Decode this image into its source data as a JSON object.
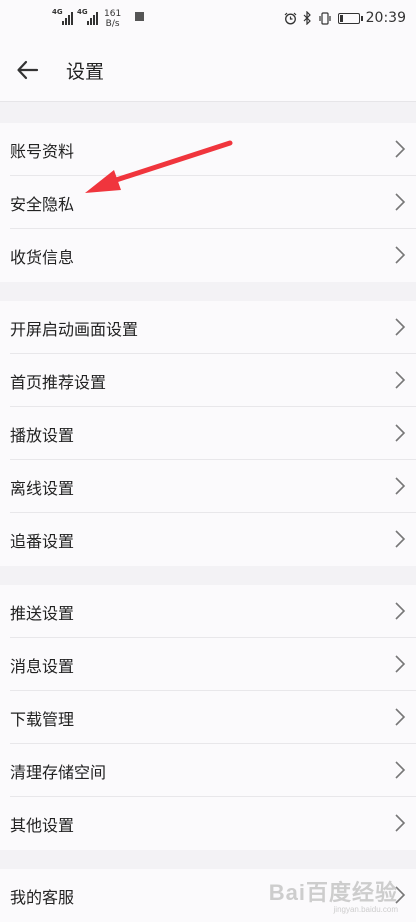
{
  "status_bar": {
    "network1": "4G",
    "network2": "4G",
    "speed_value": "161",
    "speed_unit": "B/s",
    "time": "20:39",
    "icons": [
      "alarm-icon",
      "bluetooth-icon",
      "vibrate-icon",
      "battery-icon"
    ],
    "battery_level": 0.2
  },
  "header": {
    "title": "设置",
    "back_icon": "arrow-left-icon"
  },
  "groups": [
    {
      "items": [
        "账号资料",
        "安全隐私",
        "收货信息"
      ]
    },
    {
      "items": [
        "开屏启动画面设置",
        "首页推荐设置",
        "播放设置",
        "离线设置",
        "追番设置"
      ]
    },
    {
      "items": [
        "推送设置",
        "消息设置",
        "下载管理",
        "清理存储空间",
        "其他设置"
      ]
    },
    {
      "items": [
        "我的客服"
      ]
    }
  ],
  "annotation": {
    "color": "#f0353d",
    "icon": "red-arrow-annotation"
  },
  "watermark": {
    "main": "Bai百度经验",
    "sub": "jingyan.baidu.com"
  },
  "colors": {
    "background": "#f3f2f5",
    "row_background": "#fbfafc",
    "divider": "#e8e7ea",
    "chevron": "#777777"
  }
}
